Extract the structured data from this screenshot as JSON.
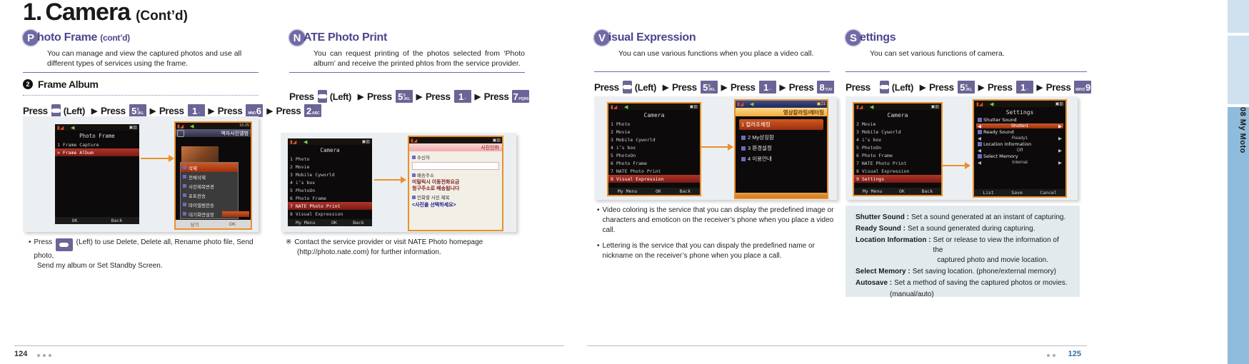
{
  "header": {
    "number": "1.",
    "title": "Camera",
    "cont": "(Cont’d)"
  },
  "sections": {
    "photo_frame": {
      "badge": "P",
      "title": "hoto Frame",
      "title_cont": "(cont’d)",
      "desc": "You can manage and view the captured photos and use all different types of services using the frame.",
      "sub_number": "❷",
      "sub_label": "Frame Album",
      "press_word": "Press",
      "left_label": "(Left)",
      "arrow": "▶",
      "keys": [
        "soft",
        "5",
        "1",
        "6",
        "2"
      ],
      "key_subs": [
        "",
        "JKL",
        "··",
        "MNO",
        "ABC"
      ],
      "note_bullet": "•",
      "note_line1": "(Left) to use Delete, Delete all, Rename photo file, Send photo,",
      "note_line2": "Send my album or Set Standby Screen.",
      "shot1": {
        "title": "Photo Frame",
        "items": [
          "1 Frame Capture",
          "> Frame Album"
        ],
        "soft_left": "OK",
        "soft_right": "Back"
      },
      "shot2": {
        "titlebar": "액자사진앨범",
        "time": "15:25",
        "popup_items": [
          "삭제",
          "전체삭제",
          "사진제목변경",
          "포토전송",
          "마이앨범전송",
          "대기화면설정"
        ],
        "btn_left": "닫기",
        "btn_right": "OK"
      }
    },
    "nate_photo_print": {
      "badge": "N",
      "title": "ATE Photo Print",
      "desc": "You can request printing of the photos selected from ‘Photo album’ and receive the printed phtos from the service provider.",
      "press_word": "Press",
      "left_label": "(Left)",
      "arrow": "▶",
      "keys": [
        "soft",
        "5",
        "1",
        "7"
      ],
      "key_subs": [
        "",
        "JKL",
        "··",
        "PQRS"
      ],
      "note_mark": "※",
      "note_line1": "Contact the service provider or visit NATE Photo homepage",
      "note_line2": "(http://photo.nate.com) for further information.",
      "shot1": {
        "title": "Camera",
        "items": [
          "1 Photo",
          "2 Movie",
          "3 Mobile Cyworld",
          "4 i’s box",
          "5 PhotoOn",
          "6 Photo Frame",
          "7 NATE Photo Print",
          "8 Visual Expression"
        ],
        "highlight_index": 6,
        "soft_left": "My Menu",
        "soft_center": "OK",
        "soft_right": "Back"
      },
      "shot2": {
        "titlebar": "사진인화",
        "field1_label": "수신자",
        "field2_label": "배송주소",
        "body_line1": "미밀릭시 이동전화요금",
        "body_line2": "청구주소로 배송됩니다",
        "field3_label": "인화할 사진 제목",
        "field3_value": "<사진을 선택하세요>"
      }
    },
    "visual_expression": {
      "badge": "V",
      "title": "isual Expression",
      "desc": "You can use various functions when you place a video call.",
      "press_word": "Press",
      "left_label": "(Left)",
      "arrow": "▶",
      "keys": [
        "soft",
        "5",
        "1",
        "8"
      ],
      "key_subs": [
        "",
        "JKL",
        "··",
        "TUV"
      ],
      "notes": [
        "Video coloring is the service that you can display the predefined image or characters and emoticon on the receiver’s phone when you place a video call.",
        "Lettering is the service that you can dispaly the predefined name or nickname on the receiver’s phone when you place a call."
      ],
      "shot1": {
        "title": "Camera",
        "items": [
          "1 Photo",
          "2 Movie",
          "3 Mobile Cyworld",
          "4 i’s box",
          "5 PhotoOn",
          "6 Photo Frame",
          "7 NATE Photo Print",
          "8 Visual Expression"
        ],
        "highlight_index": 7,
        "soft_left": "My Menu",
        "soft_center": "OK",
        "soft_right": "Back"
      },
      "shot2": {
        "titlebar": "영상칼라링/레터링",
        "items": [
          "1 컬러조체링",
          "2 My상징함",
          "3 환경설정",
          "4 이용안내"
        ]
      }
    },
    "settings": {
      "badge": "S",
      "title": "ettings",
      "desc": "You can set various functions of camera.",
      "press_word": "Press",
      "left_label": "(Left)",
      "arrow": "▶",
      "keys": [
        "soft",
        "5",
        "1",
        "9"
      ],
      "key_subs": [
        "",
        "JKL",
        "··",
        "WXYZ"
      ],
      "shot1": {
        "title": "Camera",
        "items": [
          "1 Photo",
          "2 Movie",
          "3 Mobile Cyworld",
          "4 i’s box",
          "5 PhotoOn",
          "6 Photo Frame",
          "7 NATE Photo Print",
          "8 Visual Expression",
          "9 Settings"
        ],
        "highlight_index": 8,
        "soft_left": "My Menu",
        "soft_center": "OK",
        "soft_right": "Back"
      },
      "shot2": {
        "title": "Settings",
        "rows": [
          {
            "label": "Shutter Sound",
            "value": "Shutter1",
            "hl": true
          },
          {
            "label": "Ready Sound",
            "value": "Ready1",
            "hl": false
          },
          {
            "label": "Location Information",
            "value": "Off",
            "hl": false
          },
          {
            "label": "Select Memory",
            "value": "Internal",
            "hl": false
          }
        ],
        "soft_left": "List",
        "soft_center": "Save",
        "soft_right": "Cancel"
      },
      "glossary": [
        {
          "term": "Shutter Sound :",
          "def": "Set a sound generated at an instant of capturing."
        },
        {
          "term": "Ready Sound :",
          "def": "Set a sound generated during capturing."
        },
        {
          "term": "Location Information :",
          "def": "Set or release to view the information of the",
          "cont": "captured photo and movie location."
        },
        {
          "term": "Select Memory :",
          "def": "Set saving location. (phone/external memory)"
        },
        {
          "term": "Autosave :",
          "def": "Set a method of saving the captured photos or movies.",
          "cont": "(manual/auto)"
        }
      ]
    }
  },
  "footer": {
    "page_left": "124",
    "page_right": "125"
  },
  "tabstrip": {
    "label": "08 My Moto"
  }
}
